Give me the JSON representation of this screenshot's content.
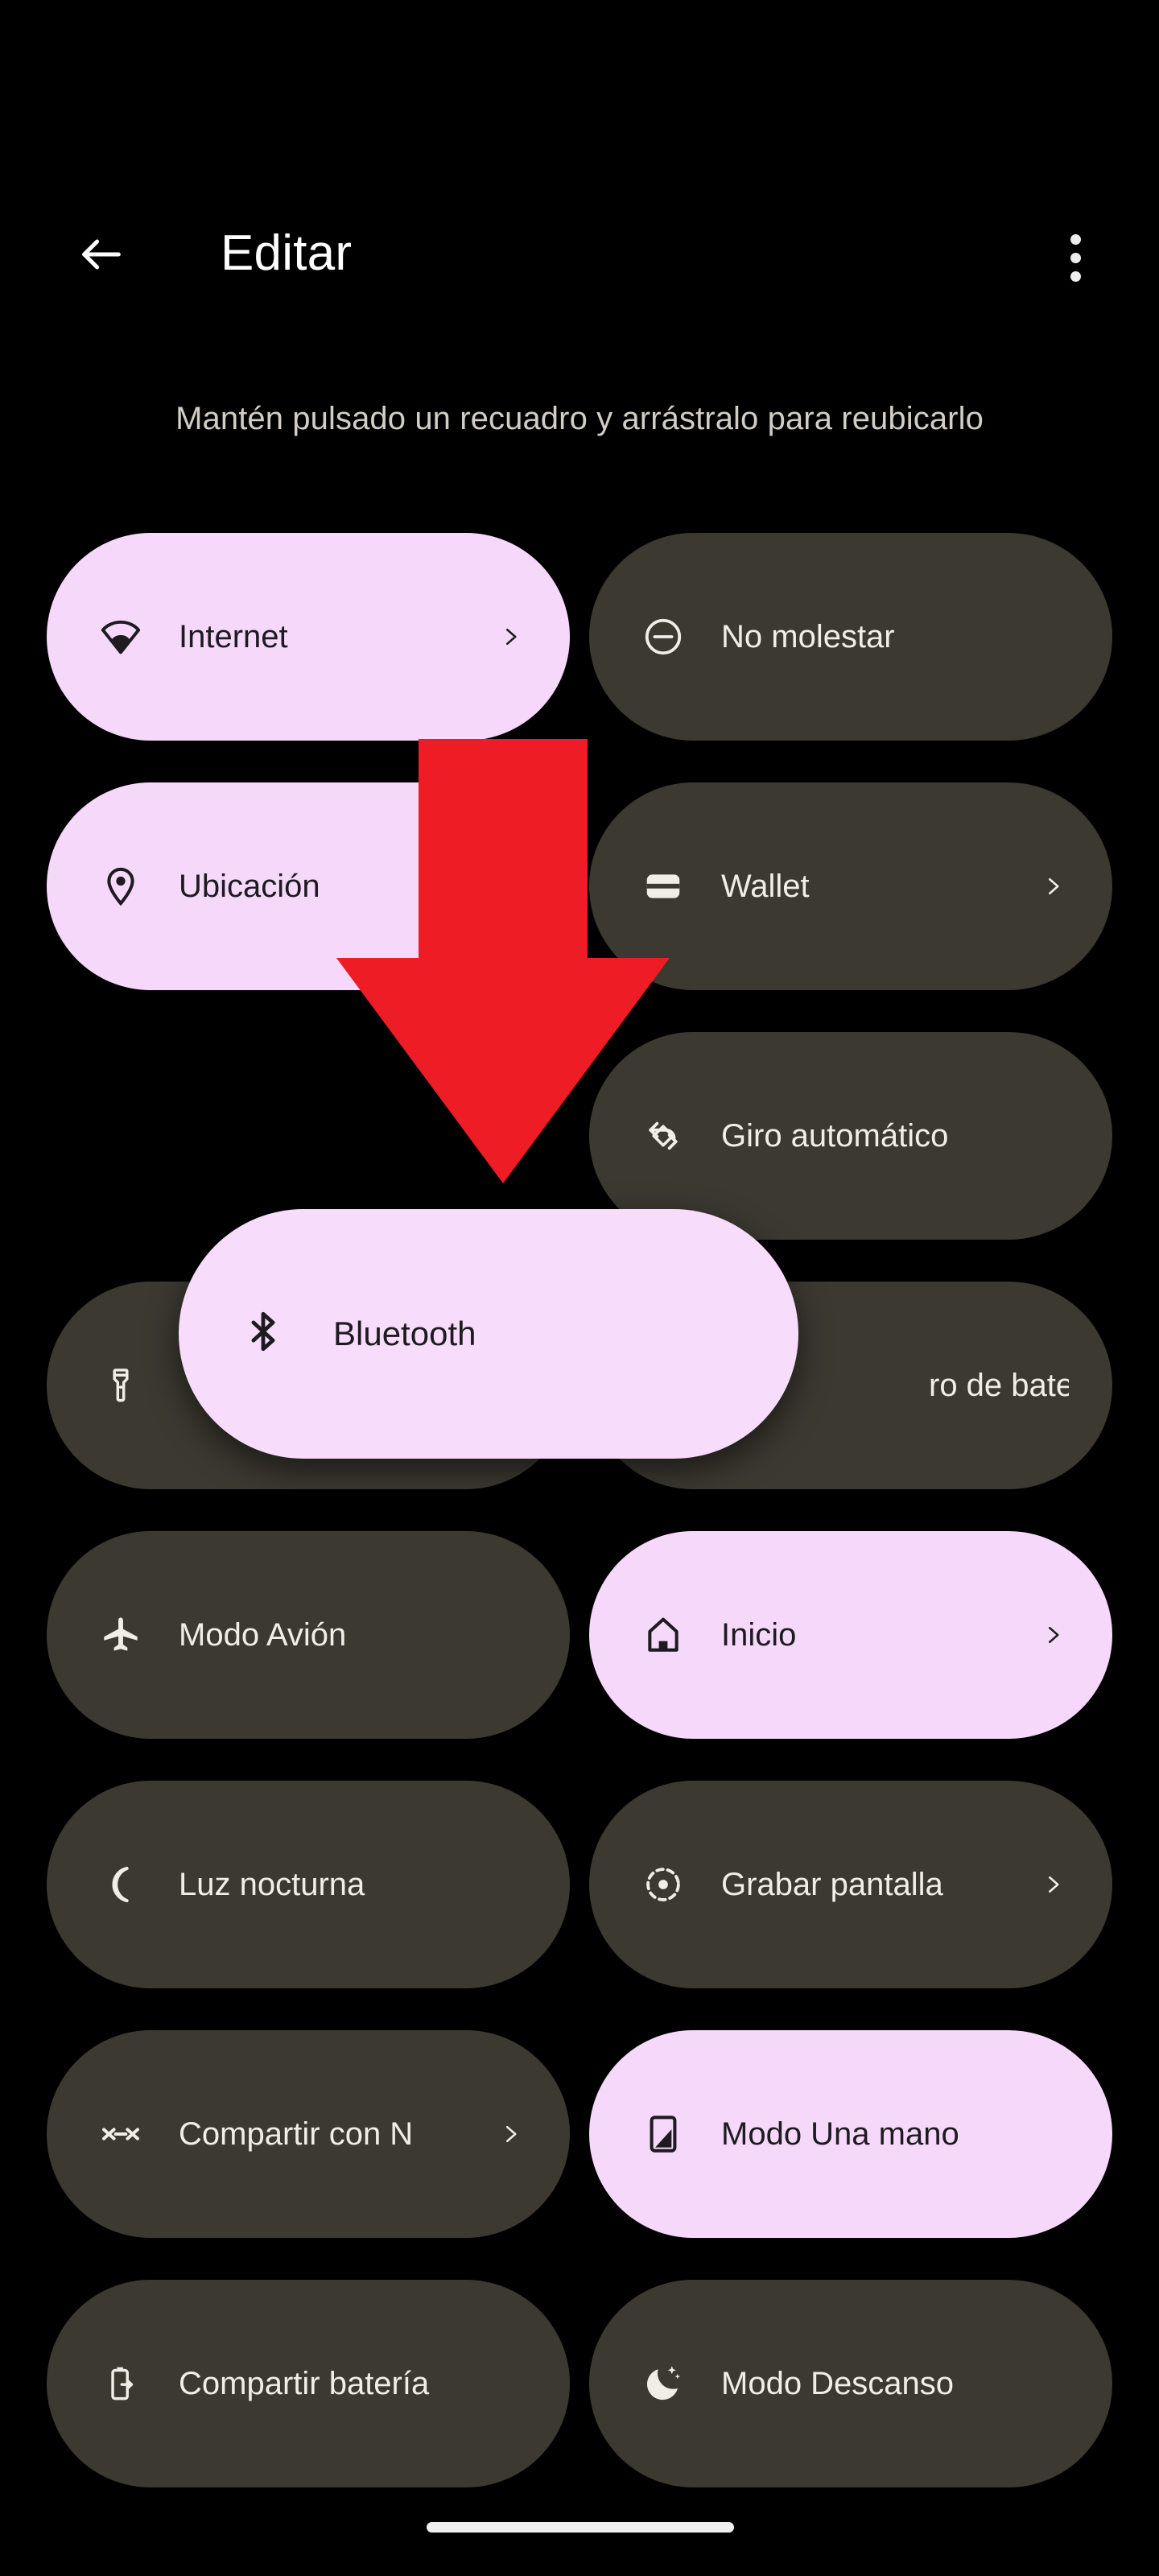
{
  "appbar": {
    "back_icon": "arrow-back-icon",
    "title": "Editar",
    "overflow_icon": "more-vert-icon"
  },
  "subtitle": "Mantén pulsado un recuadro y arrástralo para reubicarlo",
  "colors": {
    "background": "#000000",
    "tile_inactive": "#3B3930",
    "tile_active": "#F6D9FA",
    "label_inactive": "#F1EEE6",
    "label_active": "#1D1B20",
    "subtitle": "#D2CEC6",
    "arrow": "#EE1C25",
    "home_indicator": "#EFEFEF"
  },
  "tiles": [
    {
      "label": "Internet",
      "icon": "wifi-icon",
      "active": true,
      "chevron": true,
      "column": "left",
      "row": 1
    },
    {
      "label": "No molestar",
      "icon": "do-not-disturb-icon",
      "active": false,
      "chevron": false,
      "column": "right",
      "row": 1
    },
    {
      "label": "Ubicación",
      "icon": "location-pin-icon",
      "active": true,
      "chevron": false,
      "column": "left",
      "row": 2
    },
    {
      "label": "Wallet",
      "icon": "wallet-icon",
      "active": false,
      "chevron": true,
      "column": "right",
      "row": 2
    },
    {
      "label": "",
      "icon": "none-icon",
      "active": false,
      "chevron": false,
      "column": "left",
      "row": 3
    },
    {
      "label": "Giro automático",
      "icon": "auto-rotate-icon",
      "active": false,
      "chevron": false,
      "column": "right",
      "row": 3
    },
    {
      "label": "",
      "icon": "flashlight-icon",
      "active": false,
      "chevron": false,
      "column": "left",
      "row": 4
    },
    {
      "label": "ro de batería",
      "icon": "none-icon",
      "active": false,
      "chevron": false,
      "column": "right",
      "row": 4
    },
    {
      "label": "Modo Avión",
      "icon": "airplane-icon",
      "active": false,
      "chevron": false,
      "column": "left",
      "row": 5
    },
    {
      "label": "Inicio",
      "icon": "home-icon",
      "active": true,
      "chevron": true,
      "column": "right",
      "row": 5
    },
    {
      "label": "Luz nocturna",
      "icon": "night-light-icon",
      "active": false,
      "chevron": false,
      "column": "left",
      "row": 6
    },
    {
      "label": "Grabar pantalla",
      "icon": "screen-record-icon",
      "active": false,
      "chevron": true,
      "column": "right",
      "row": 6
    },
    {
      "label": "Compartir con N",
      "icon": "nearby-share-icon",
      "active": false,
      "chevron": true,
      "column": "left",
      "row": 7
    },
    {
      "label": "Modo Una mano",
      "icon": "one-handed-icon",
      "active": true,
      "chevron": false,
      "column": "right",
      "row": 7
    },
    {
      "label": "Compartir batería",
      "icon": "battery-share-icon",
      "active": false,
      "chevron": false,
      "column": "left",
      "row": 8
    },
    {
      "label": "Modo Descanso",
      "icon": "bedtime-icon",
      "active": false,
      "chevron": false,
      "column": "right",
      "row": 8
    }
  ],
  "dragged_tile": {
    "label": "Bluetooth",
    "icon": "bluetooth-icon",
    "active": true
  },
  "annotation": {
    "arrow_icon": "red-down-arrow-icon",
    "arrow_color": "#EE1C25"
  },
  "home_indicator": {
    "present": true
  }
}
